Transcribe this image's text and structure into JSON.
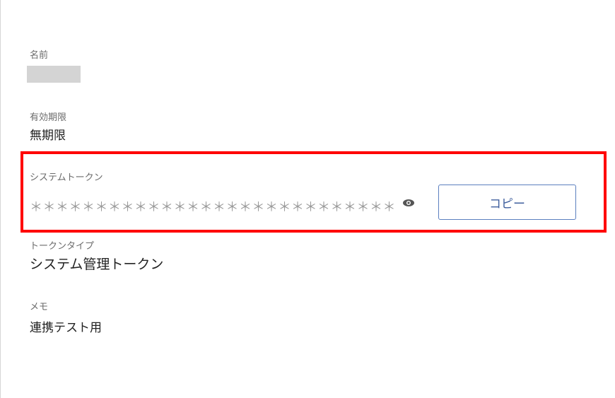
{
  "fields": {
    "name": {
      "label": "名前",
      "value": ""
    },
    "expiry": {
      "label": "有効期限",
      "value": "無期限"
    },
    "system_token": {
      "label": "システムトークン",
      "masked_value": "＊＊＊＊＊＊＊＊＊＊＊＊＊＊＊＊＊＊＊＊＊＊＊＊＊＊＊＊",
      "reveal_icon": "eye-icon",
      "copy_label": "コピー"
    },
    "token_type": {
      "label": "トークンタイプ",
      "value": "システム管理トークン"
    },
    "memo": {
      "label": "メモ",
      "value": "連携テスト用"
    }
  },
  "colors": {
    "highlight": "#ff0000",
    "button_border": "#5b7fbf",
    "button_text": "#3f5f9e",
    "label": "#6b6b6b",
    "value": "#222222",
    "redacted": "#d4d4d4"
  }
}
